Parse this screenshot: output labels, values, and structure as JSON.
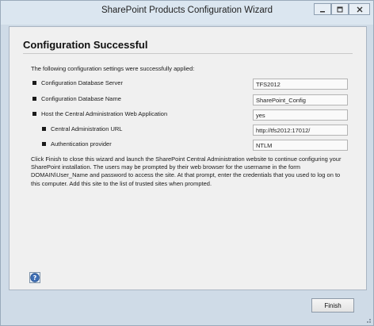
{
  "window": {
    "title": "SharePoint Products Configuration Wizard",
    "controls": {
      "minimize_icon": "minimize-icon",
      "maximize_icon": "maximize-icon",
      "close_icon": "close-icon"
    }
  },
  "page": {
    "heading": "Configuration Successful",
    "intro": "The following configuration settings were successfully applied:",
    "settings": [
      {
        "label": "Configuration Database Server",
        "value": "TFS2012"
      },
      {
        "label": "Configuration Database Name",
        "value": "SharePoint_Config"
      },
      {
        "label": "Host the Central Administration Web Application",
        "value": "yes"
      },
      {
        "label": "Central Administration URL",
        "value": "http://tfs2012:17012/"
      },
      {
        "label": "Authentication provider",
        "value": "NTLM"
      }
    ],
    "description": "Click Finish to close this wizard and launch the SharePoint Central Administration website to continue configuring your SharePoint installation. The users may be prompted by their web browser for the username in the form DOMAIN\\User_Name and password to access the site. At that prompt, enter the credentials that you used to log on to this computer. Add this site to the list of trusted sites when prompted."
  },
  "footer": {
    "help_icon": "help-icon",
    "finish_label": "Finish"
  },
  "colors": {
    "window_frame": "#cfdbe7",
    "panel_background": "#f0f0f0",
    "help_icon_blue": "#3f6fb5"
  }
}
